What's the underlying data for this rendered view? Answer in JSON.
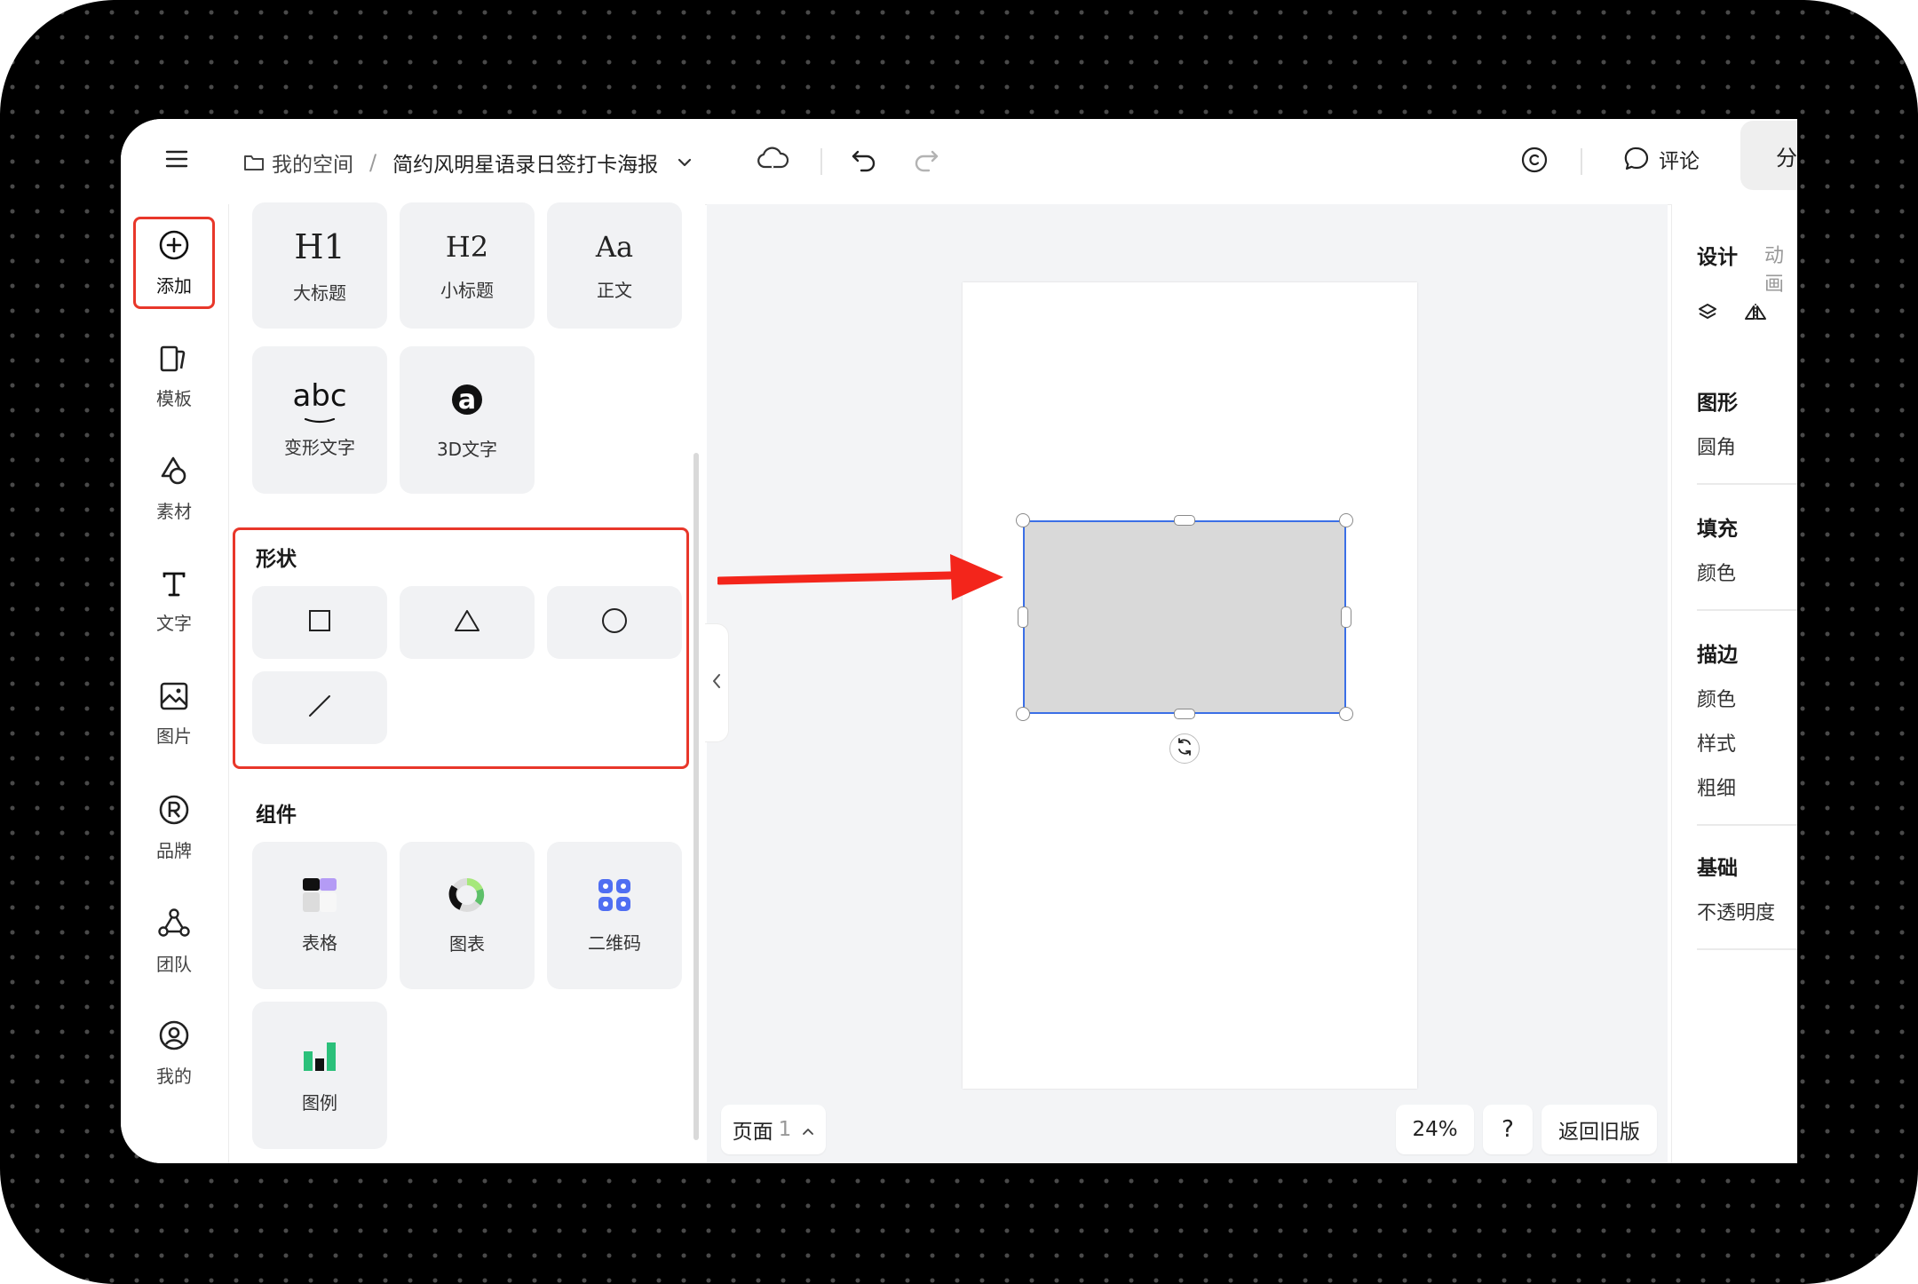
{
  "topbar": {
    "breadcrumb_space": "我的空间",
    "breadcrumb_sep": "/",
    "document_title": "简约风明星语录日签打卡海报",
    "comment_label": "评论",
    "share_label": "分"
  },
  "rail": {
    "items": [
      {
        "label": "添加",
        "icon": "plus-circle-icon"
      },
      {
        "label": "模板",
        "icon": "template-icon"
      },
      {
        "label": "素材",
        "icon": "material-icon"
      },
      {
        "label": "文字",
        "icon": "text-icon"
      },
      {
        "label": "图片",
        "icon": "image-icon"
      },
      {
        "label": "品牌",
        "icon": "registered-icon"
      },
      {
        "label": "团队",
        "icon": "team-icon"
      },
      {
        "label": "我的",
        "icon": "user-icon"
      }
    ]
  },
  "panel": {
    "text_tiles": [
      {
        "glyph": "H1",
        "label": "大标题"
      },
      {
        "glyph": "H2",
        "label": "小标题"
      },
      {
        "glyph": "Aa",
        "label": "正文"
      },
      {
        "glyph": "abc",
        "label": "变形文字"
      },
      {
        "glyph": "a",
        "label": "3D文字"
      }
    ],
    "shapes_title": "形状",
    "components_title": "组件",
    "components": [
      {
        "label": "表格",
        "icon": "table-icon"
      },
      {
        "label": "图表",
        "icon": "donut-chart-icon"
      },
      {
        "label": "二维码",
        "icon": "qrcode-icon"
      },
      {
        "label": "图例",
        "icon": "bar-legend-icon"
      }
    ]
  },
  "bottom": {
    "page_label": "页面",
    "page_number": "1",
    "zoom": "24%",
    "help": "?",
    "back_old": "返回旧版"
  },
  "right_panel": {
    "tabs": [
      "设计",
      "动画"
    ],
    "sections": [
      {
        "title": "图形",
        "items": [
          "圆角"
        ]
      },
      {
        "title": "填充",
        "items": [
          "颜色"
        ]
      },
      {
        "title": "描边",
        "items": [
          "颜色",
          "样式",
          "粗细"
        ]
      },
      {
        "title": "基础",
        "items": [
          "不透明度"
        ]
      }
    ]
  },
  "colors": {
    "highlight": "#e8372a",
    "selection": "#3b6fe6",
    "shape_fill": "#d9d9d9",
    "canvas_bg": "#f3f4f6"
  }
}
